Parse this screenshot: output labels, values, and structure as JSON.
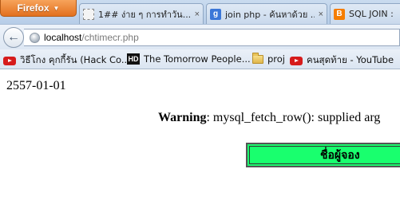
{
  "browser": {
    "app_button_label": "Firefox",
    "tabs": [
      {
        "title": "1## ง่าย ๆ การทำวัน...",
        "close": "×"
      },
      {
        "title": "join php - ค้นหาด้วย ...",
        "close": "×"
      },
      {
        "title": "SQL JOIN :",
        "close": ""
      }
    ],
    "url_host": "localhost",
    "url_path": "/chtimecr.php",
    "bookmarks": [
      {
        "label": "วิธีโกง คุกกี้รัน (Hack Co...",
        "icon": "youtube-icon"
      },
      {
        "label": "The Tomorrow People...",
        "icon": "hd-icon"
      },
      {
        "label": "proj",
        "icon": "folder-icon"
      },
      {
        "label": "คนสุดท้าย - YouTube",
        "icon": "youtube-icon"
      }
    ]
  },
  "page": {
    "date": "2557-01-01",
    "warning_label": "Warning",
    "warning_message": ": mysql_fetch_row(): supplied arg",
    "header_cell": "ชื่อผู้จอง"
  },
  "colors": {
    "firefox_orange": "#e2701f",
    "header_green": "#19ff6e",
    "youtube_red": "#d61b1b"
  }
}
